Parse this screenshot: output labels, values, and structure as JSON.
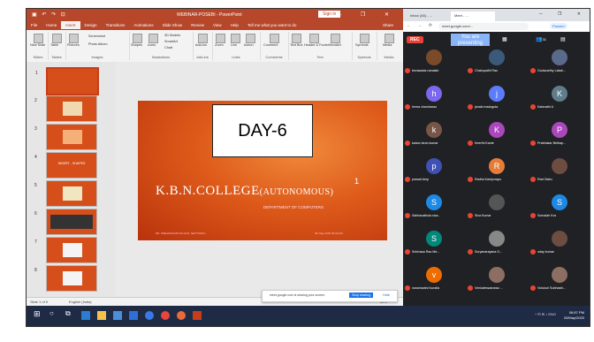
{
  "ppt": {
    "title": "WEBINAR-POSEBI - PowerPoint",
    "sign_in": "Sign in",
    "tabs": [
      "File",
      "Home",
      "Insert",
      "Design",
      "Transitions",
      "Animations",
      "Slide Show",
      "Review",
      "View",
      "Help",
      "Tell me what you want to do"
    ],
    "share": "Share",
    "ribbon": {
      "groups": [
        "Slides",
        "Tables",
        "Images",
        "Illustrations",
        "Add-ins",
        "Links",
        "Comments",
        "Text",
        "Symbols",
        "Media"
      ],
      "items": [
        "New Slide",
        "Table",
        "Pictures",
        "Screenshot",
        "Photo Album",
        "Shapes",
        "Icons",
        "3D Models",
        "SmartArt",
        "Chart",
        "Add-ins",
        "Zoom",
        "Link",
        "Action",
        "Comment",
        "Text Box",
        "Header & Footer",
        "WordArt",
        "Symbols",
        "Media"
      ]
    },
    "thumb_numbers": [
      "1",
      "2",
      "3",
      "4",
      "5",
      "6",
      "7",
      "8"
    ],
    "thumb4_text": "INSERT - SHAPES",
    "slide": {
      "title_main": "K.B.N.COLLEGE",
      "title_small": "(AUTONOMOUS)",
      "number": "1",
      "department": "DEPARTMENT OF COMPUTERS",
      "footer_left": "DR. PREAMANANTHA RAO, NETTIPADU",
      "footer_right": "6th May 2020 09:30 AM"
    },
    "status_left": "Slide 1 of 9",
    "status_lang": "English (India)",
    "zoom": "65%"
  },
  "overlay": {
    "day_label": "DAY-6"
  },
  "sharebar": {
    "message": "meet.google.com is sharing your screen.",
    "stop": "Stop sharing",
    "hide": "Hide"
  },
  "chrome": {
    "tab1": "Inbox (46) - ...",
    "tab2": "Meet - ...",
    "url": "meet.google.com/...",
    "paused": "Paused"
  },
  "meet": {
    "rec": "REC",
    "presenting": "You are presenting",
    "participants_count": "31",
    "participants": [
      {
        "name": "bezawada ramaiah",
        "initial": "",
        "color": "#7a4a2a"
      },
      {
        "name": "Chabupathi Rao",
        "initial": "",
        "color": "#3b5a7a"
      },
      {
        "name": "Godavarthy Laksh...",
        "initial": "",
        "color": "#5a6a8a"
      },
      {
        "name": "hema chandrarao",
        "initial": "h",
        "color": "#7b68ee"
      },
      {
        "name": "janaki madugula",
        "initial": "j",
        "color": "#5c7cfa"
      },
      {
        "name": "Kalavathi A",
        "initial": "K",
        "color": "#607d8b"
      },
      {
        "name": "katam kiran kumar",
        "initial": "k",
        "color": "#795548"
      },
      {
        "name": "Keerthi Kante",
        "initial": "K",
        "color": "#ab47bc"
      },
      {
        "name": "Prabhakar Bethap...",
        "initial": "P",
        "color": "#ab47bc"
      },
      {
        "name": "prasad Amp",
        "initial": "p",
        "color": "#3f51b5"
      },
      {
        "name": "Radha Kanipurapu",
        "initial": "R",
        "color": "#e67c3a"
      },
      {
        "name": "Ravi Babu",
        "initial": "",
        "color": "#6d4c41"
      },
      {
        "name": "Sabhavathula siva...",
        "initial": "S",
        "color": "#1e88e5"
      },
      {
        "name": "Siva Kumar",
        "initial": "",
        "color": "#555"
      },
      {
        "name": "Somaiah Kvs",
        "initial": "S",
        "color": "#1e88e5"
      },
      {
        "name": "Srinivasa Rao Me...",
        "initial": "S",
        "color": "#00897b"
      },
      {
        "name": "Suryanarayana G...",
        "initial": "",
        "color": "#888"
      },
      {
        "name": "uday kumar",
        "initial": "",
        "color": "#6d4c41"
      },
      {
        "name": "vanamadevi kuralla",
        "initial": "v",
        "color": "#ef6c00"
      },
      {
        "name": "Venkateswararao ...",
        "initial": "",
        "color": "#8d6e63"
      },
      {
        "name": "Vutukuri Subhashi...",
        "initial": "",
        "color": "#8d6e63"
      }
    ]
  },
  "taskbar": {
    "time": "06:57 PM",
    "date": "20/May/2020",
    "lang": "ENG"
  }
}
